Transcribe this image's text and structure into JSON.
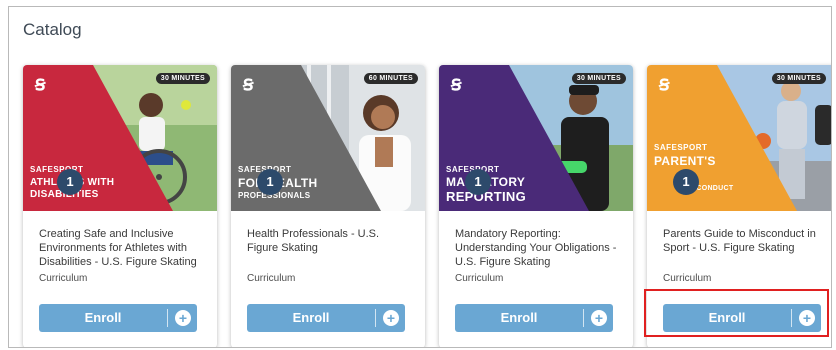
{
  "catalog": {
    "title": "Catalog",
    "courses": [
      {
        "title": "Creating Safe and Inclusive Environments for Athletes with Disabilities - U.S. Figure Skating",
        "type": "Curriculum",
        "duration": "30 MINUTES",
        "brand": "SAFESPORT",
        "thumb_line1": "ATHLETES WITH",
        "thumb_line2": "DISABILITIES",
        "badge": "1",
        "enroll_label": "Enroll",
        "accent_color": "#c8283e"
      },
      {
        "title": "Health Professionals - U.S. Figure Skating",
        "type": "Curriculum",
        "duration": "60 MINUTES",
        "brand": "SAFESPORT",
        "thumb_line1": "FOR HEALTH",
        "thumb_line2": "PROFESSIONALS",
        "badge": "1",
        "enroll_label": "Enroll",
        "accent_color": "#6b6b6b"
      },
      {
        "title": "Mandatory Reporting: Understanding Your Obligations - U.S. Figure Skating",
        "type": "Curriculum",
        "duration": "30 MINUTES",
        "brand": "SAFESPORT",
        "thumb_line1": "MANDATORY",
        "thumb_line2": "REPORTING",
        "badge": "1",
        "enroll_label": "Enroll",
        "accent_color": "#4a2a78"
      },
      {
        "title": "Parents Guide to Misconduct in Sport - U.S. Figure Skating",
        "type": "Curriculum",
        "duration": "30 MINUTES",
        "brand": "SAFESPORT",
        "thumb_line1": "PARENT'S",
        "thumb_line2": "MISCONDUCT",
        "badge": "1",
        "enroll_label": "Enroll",
        "accent_color": "#f0a030"
      }
    ]
  }
}
